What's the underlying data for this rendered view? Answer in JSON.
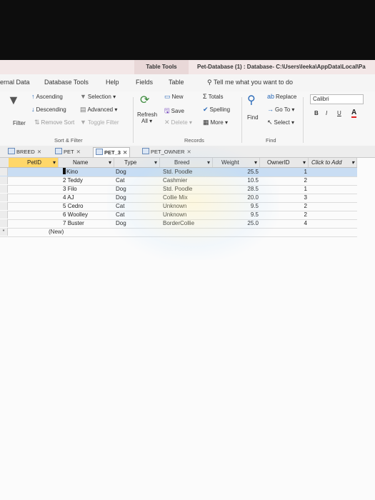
{
  "context": {
    "table_tools": "Table Tools",
    "window_title": "Pet-Database (1) : Database- C:\\Users\\leeka\\AppData\\Local\\Pa"
  },
  "tabs": [
    "ernal Data",
    "Database Tools",
    "Help",
    "Fields",
    "Table"
  ],
  "tell_me": "Tell me what you want to do",
  "ribbon": {
    "filter": "Filter",
    "ascending": "Ascending",
    "descending": "Descending",
    "remove_sort": "Remove Sort",
    "selection": "Selection",
    "advanced": "Advanced",
    "toggle_filter": "Toggle Filter",
    "sort_filter_label": "Sort & Filter",
    "refresh": "Refresh",
    "refresh_all": "All",
    "new": "New",
    "save": "Save",
    "delete": "Delete",
    "totals": "Totals",
    "spelling": "Spelling",
    "more": "More",
    "records_label": "Records",
    "find": "Find",
    "replace": "Replace",
    "goto": "Go To",
    "select": "Select",
    "find_label": "Find",
    "font": "Calibri",
    "bold": "B",
    "italic": "I",
    "underline": "U",
    "font_color": "A"
  },
  "doc_tabs": [
    {
      "label": "BREED",
      "active": false
    },
    {
      "label": "PET",
      "active": false
    },
    {
      "label": "PET_3",
      "active": true
    },
    {
      "label": "PET_OWNER",
      "active": false
    }
  ],
  "columns": [
    "PetID",
    "Name",
    "Type",
    "Breed",
    "Weight",
    "OwnerID",
    "Click to Add"
  ],
  "rows": [
    {
      "name": "Kino",
      "type": "Dog",
      "breed": "Std. Poodle",
      "weight": "25.5",
      "owner": "1"
    },
    {
      "name": "Teddy",
      "type": "Cat",
      "breed": "Cashmier",
      "weight": "10.5",
      "owner": "2"
    },
    {
      "name": "Filo",
      "type": "Dog",
      "breed": "Std. Poodle",
      "weight": "28.5",
      "owner": "1"
    },
    {
      "name": "AJ",
      "type": "Dog",
      "breed": "Collie Mix",
      "weight": "20.0",
      "owner": "3"
    },
    {
      "name": "Cedro",
      "type": "Cat",
      "breed": "Unknown",
      "weight": "9.5",
      "owner": "2"
    },
    {
      "name": "Woolley",
      "type": "Cat",
      "breed": "Unknown",
      "weight": "9.5",
      "owner": "2"
    },
    {
      "name": "Buster",
      "type": "Dog",
      "breed": "BorderCollie",
      "weight": "25.0",
      "owner": "4"
    }
  ],
  "row_ids": [
    "1",
    "2",
    "3",
    "4",
    "5",
    "6",
    "7"
  ],
  "new_row": "(New)",
  "new_row_marker": "*"
}
